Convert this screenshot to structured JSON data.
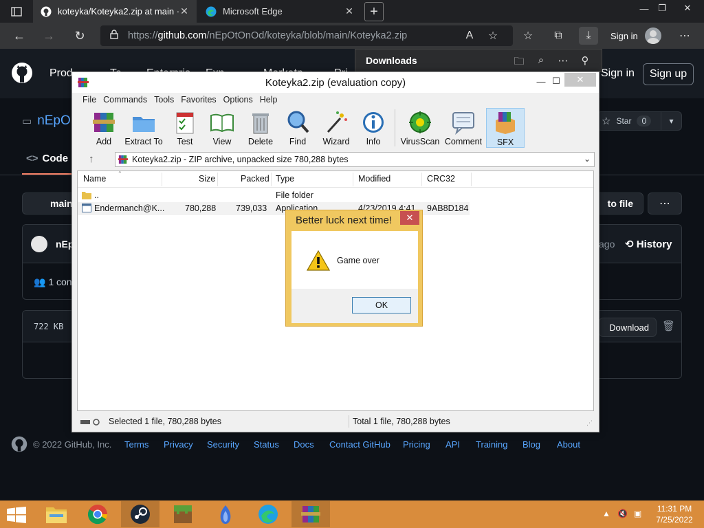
{
  "browser": {
    "tabs": [
      {
        "title": "koteyka/Koteyka2.zip at main · n",
        "active": true
      },
      {
        "title": "Microsoft Edge",
        "active": false
      }
    ],
    "url_prefix": "https://",
    "url_domain": "github.com",
    "url_path": "/nEpOtOnOd/koteyka/blob/main/Koteyka2.zip",
    "signin_label": "Sign in",
    "downloads_title": "Downloads"
  },
  "github": {
    "nav": [
      "Prod",
      "Te",
      "Enterpris",
      "Exp",
      "Marketp",
      "Pri"
    ],
    "sign_in": "Sign in",
    "sign_up": "Sign up",
    "repo_owner_partial": "nEpO",
    "star_label": "Star",
    "star_count": "0",
    "code_tab": "Code",
    "branch_partial": "main",
    "goto_file_partial": "to file",
    "commit_user_partial": "nEp",
    "commit_ago_partial": "ago",
    "history_label": "History",
    "contributors_partial": "1 cont",
    "file_size": "722 KB",
    "download_label": "Download",
    "footer": {
      "copyright": "© 2022 GitHub, Inc.",
      "links": [
        "Terms",
        "Privacy",
        "Security",
        "Status",
        "Docs",
        "Contact GitHub",
        "Pricing",
        "API",
        "Training",
        "Blog",
        "About"
      ]
    }
  },
  "winrar": {
    "title": "Koteyka2.zip (evaluation copy)",
    "menu": [
      "File",
      "Commands",
      "Tools",
      "Favorites",
      "Options",
      "Help"
    ],
    "toolbar": [
      "Add",
      "Extract To",
      "Test",
      "View",
      "Delete",
      "Find",
      "Wizard",
      "Info",
      "VirusScan",
      "Comment",
      "SFX"
    ],
    "path_text": "Koteyka2.zip - ZIP archive, unpacked size 780,288 bytes",
    "columns": [
      "Name",
      "Size",
      "Packed",
      "Type",
      "Modified",
      "CRC32"
    ],
    "rows": [
      {
        "name": "..",
        "size": "",
        "packed": "",
        "type": "File folder",
        "modified": "",
        "crc": ""
      },
      {
        "name": "Endermanch@K...",
        "size": "780,288",
        "packed": "739,033",
        "type": "Application",
        "modified": "4/23/2019 4:41",
        "crc": "9AB8D184"
      }
    ],
    "status_left": "Selected 1 file, 780,288 bytes",
    "status_right": "Total 1 file, 780,288 bytes"
  },
  "dialog": {
    "title": "Better luck next time!",
    "message": "Game over",
    "ok_label": "OK"
  },
  "taskbar": {
    "time": "11:31 PM",
    "date": "7/25/2022"
  },
  "colors": {
    "taskbar": "#d98c3c",
    "github_bg": "#0d1117",
    "link": "#58a6ff",
    "dialog_frame": "#f0c860"
  }
}
